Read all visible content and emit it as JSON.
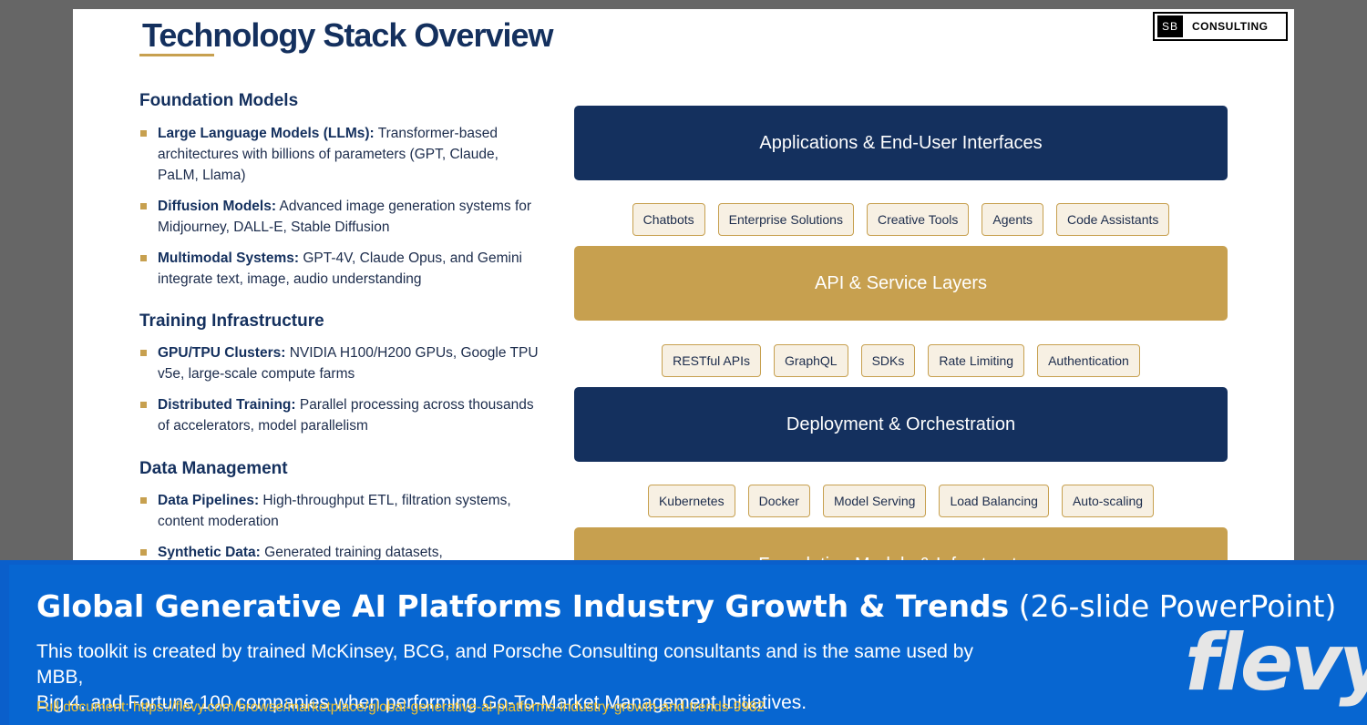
{
  "slide": {
    "title": "Technology Stack Overview",
    "logo": {
      "mark": "SB",
      "text": "CONSULTING"
    },
    "sections": [
      {
        "heading": "Foundation Models",
        "bullets": [
          {
            "bold": "Large Language Models (LLMs):",
            "text": " Transformer-based architectures with billions of parameters (GPT, Claude, PaLM, Llama)"
          },
          {
            "bold": "Diffusion Models:",
            "text": " Advanced image generation systems for Midjourney, DALL-E, Stable Diffusion"
          },
          {
            "bold": "Multimodal Systems:",
            "text": " GPT-4V, Claude Opus, and Gemini integrate text, image, audio understanding"
          }
        ]
      },
      {
        "heading": "Training Infrastructure",
        "bullets": [
          {
            "bold": "GPU/TPU Clusters:",
            "text": " NVIDIA H100/H200 GPUs, Google TPU v5e, large-scale compute farms"
          },
          {
            "bold": "Distributed Training:",
            "text": " Parallel processing across thousands of accelerators, model parallelism"
          }
        ]
      },
      {
        "heading": "Data Management",
        "bullets": [
          {
            "bold": "Data Pipelines:",
            "text": " High-throughput ETL, filtration systems, content moderation"
          },
          {
            "bold": "Synthetic Data:",
            "text": " Generated training datasets,"
          }
        ]
      }
    ],
    "stack": [
      {
        "label": "Applications & End-User Interfaces",
        "color": "navy",
        "items": [
          "Chatbots",
          "Enterprise Solutions",
          "Creative Tools",
          "Agents",
          "Code Assistants"
        ]
      },
      {
        "label": "API & Service Layers",
        "color": "gold",
        "items": [
          "RESTful APIs",
          "GraphQL",
          "SDKs",
          "Rate Limiting",
          "Authentication"
        ]
      },
      {
        "label": "Deployment & Orchestration",
        "color": "navy",
        "items": [
          "Kubernetes",
          "Docker",
          "Model Serving",
          "Load Balancing",
          "Auto-scaling"
        ]
      },
      {
        "label": "Foundation Models & Infrastructure",
        "color": "gold",
        "items": []
      }
    ],
    "colors": {
      "navy": "#14305e",
      "gold": "#c7a04f"
    }
  },
  "banner": {
    "title_bold": "Global Generative AI Platforms Industry Growth & Trends",
    "title_suffix": " (26-slide PowerPoint)",
    "desc_line1": "This toolkit is created by trained McKinsey, BCG, and Porsche Consulting consultants and is the same used by MBB,",
    "desc_line2": "Big 4, and Fortune 100 companies when performing Go-To-Market Management Initiatives.",
    "url": "Full document: https://flevy.com/browse/marketplace/global-generative-ai-platforms-industry-growth-and-trends-9982",
    "brand": "flevy"
  }
}
